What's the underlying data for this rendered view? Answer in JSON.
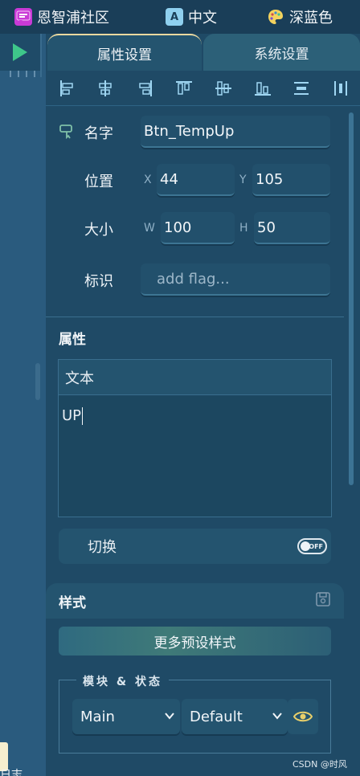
{
  "topbar": {
    "community_label": "恩智浦社区",
    "language_label": "中文",
    "theme_label": "深蓝色",
    "language_icon_text": "A",
    "colors": {
      "community_icon": "#c93ad6",
      "lang_icon": "#8fd0ef",
      "theme_icon": "#f4d35e"
    }
  },
  "tabs": [
    {
      "label": "属性设置",
      "active": true
    },
    {
      "label": "系统设置",
      "active": false
    }
  ],
  "toolbar": {
    "icons": [
      "align-left-icon",
      "align-h-center-icon",
      "align-right-icon",
      "align-top-icon",
      "align-v-center-icon",
      "align-bottom-icon",
      "distribute-vertical-icon",
      "distribute-horizontal-icon"
    ]
  },
  "props": {
    "name_label": "名字",
    "name_value": "Btn_TempUp",
    "position_label": "位置",
    "x_label": "X",
    "x_value": "44",
    "y_label": "Y",
    "y_value": "105",
    "size_label": "大小",
    "w_label": "W",
    "w_value": "100",
    "h_label": "H",
    "h_value": "50",
    "flag_label": "标识",
    "flag_placeholder": "add flag..."
  },
  "attributes": {
    "title": "属性",
    "text_label": "文本",
    "text_value": "UP",
    "switch_label": "切换",
    "toggle_text": "OFF"
  },
  "style": {
    "title": "样式",
    "more_button": "更多预设样式",
    "module_state_legend": "模块 & 状态",
    "module_value": "Main",
    "state_value": "Default"
  },
  "bottom_left_text": "日志",
  "watermark": "CSDN @时风",
  "colors": {
    "accent_green": "#3ec78a",
    "eye_icon": "#e8cf6a",
    "active_tab_border": "#ecd9a0"
  }
}
